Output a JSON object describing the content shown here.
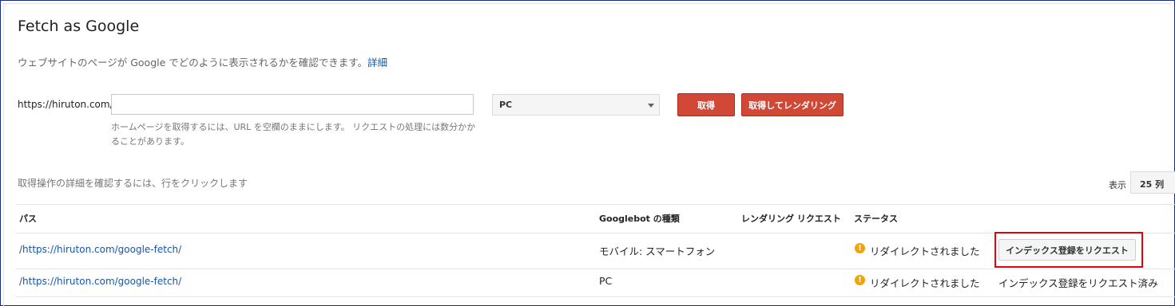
{
  "header": {
    "title": "Fetch as Google",
    "subtitle": "ウェブサイトのページが Google でどのように表示されるかを確認できます。",
    "details_link": "詳細"
  },
  "fetch_form": {
    "url_prefix": "https://hiruton.com/",
    "url_value": "",
    "hint": "ホームページを取得するには、URL を空欄のままにします。 リクエストの処理には数分かかることがあります。",
    "device_select": "PC",
    "fetch_button": "取得",
    "fetch_render_button": "取得してレンダリング"
  },
  "table_controls": {
    "click_hint": "取得操作の詳細を確認するには、行をクリックします",
    "show_label": "表示",
    "rows_per_page": "25 列"
  },
  "table": {
    "headers": {
      "path": "パス",
      "googlebot_type": "Googlebot の種類",
      "render_request": "レンダリング リクエスト",
      "status": "ステータス"
    },
    "rows": [
      {
        "path": "/https://hiruton.com/google-fetch/",
        "googlebot_type": "モバイル: スマートフォン",
        "render_request": "",
        "status": "リダイレクトされました",
        "action_button": "インデックス登録をリクエスト"
      },
      {
        "path": "/https://hiruton.com/google-fetch/",
        "googlebot_type": "PC",
        "render_request": "",
        "status": "リダイレクトされました",
        "action_text": "インデックス登録をリクエスト済み"
      }
    ]
  },
  "colors": {
    "accent_red": "#d14836",
    "link_blue": "#1a55a5",
    "warning_orange": "#f0a30a",
    "highlight_red": "#e3000f"
  }
}
